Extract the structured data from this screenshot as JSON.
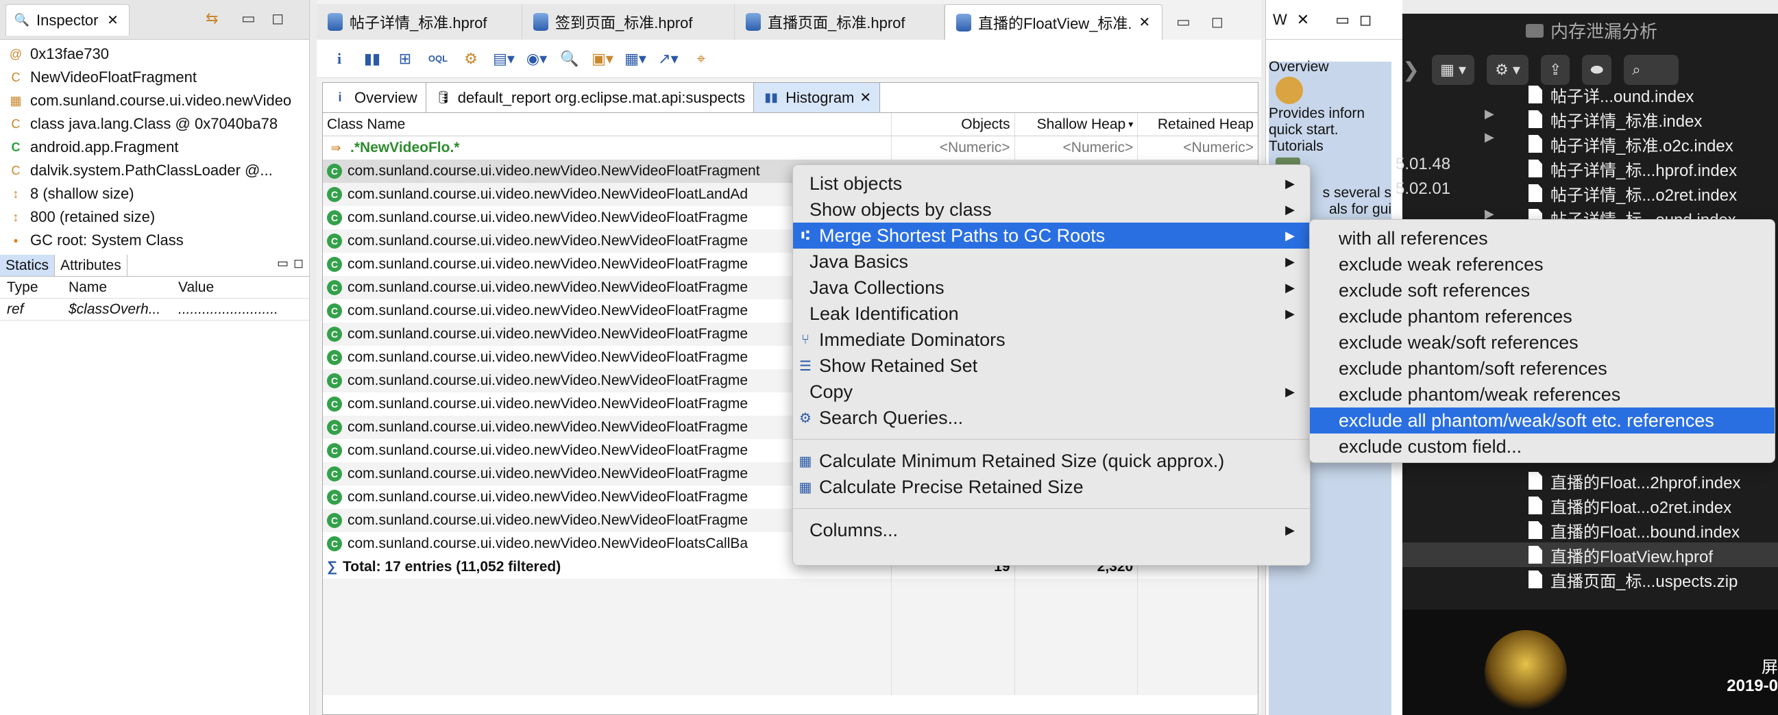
{
  "inspector": {
    "tab_label": "Inspector",
    "rows": [
      {
        "icon": "at-icon",
        "text": "0x13fae730"
      },
      {
        "icon": "class-icon",
        "text": "NewVideoFloatFragment"
      },
      {
        "icon": "package-icon",
        "text": "com.sunland.course.ui.video.newVideo"
      },
      {
        "icon": "class-object-icon",
        "text": "class java.lang.Class @ 0x7040ba78"
      },
      {
        "icon": "superclass-icon",
        "text": "android.app.Fragment"
      },
      {
        "icon": "classloader-icon",
        "text": "dalvik.system.PathClassLoader @..."
      },
      {
        "icon": "size-icon",
        "text": "8 (shallow size)"
      },
      {
        "icon": "size-icon",
        "text": "800 (retained size)"
      },
      {
        "icon": "gc-root-icon",
        "text": "GC root: System Class"
      }
    ],
    "sub_tabs": [
      "Statics",
      "Attributes"
    ],
    "columns": [
      "Type",
      "Name",
      "Value"
    ],
    "values": [
      {
        "type": "ref",
        "name": "$classOverh...",
        "value": "........................."
      }
    ]
  },
  "editor": {
    "tabs": [
      "帖子详情_标准.hprof",
      "签到页面_标准.hprof",
      "直播页面_标准.hprof",
      "直播的FloatView_标准."
    ],
    "sub_tabs": [
      "Overview",
      "default_report  org.eclipse.mat.api:suspects",
      "Histogram"
    ],
    "columns": {
      "class_name": "Class Name",
      "objects": "Objects",
      "shallow": "Shallow Heap",
      "retained": "Retained Heap"
    },
    "filter_row": {
      "class": ".*NewVideoFlo.*",
      "objects": "<Numeric>",
      "shallow": "<Numeric>",
      "retained": "<Numeric>"
    },
    "rows": [
      "com.sunland.course.ui.video.newVideo.NewVideoFloatFragment",
      "com.sunland.course.ui.video.newVideo.NewVideoFloatLandAd",
      "com.sunland.course.ui.video.newVideo.NewVideoFloatFragme",
      "com.sunland.course.ui.video.newVideo.NewVideoFloatFragme",
      "com.sunland.course.ui.video.newVideo.NewVideoFloatFragme",
      "com.sunland.course.ui.video.newVideo.NewVideoFloatFragme",
      "com.sunland.course.ui.video.newVideo.NewVideoFloatFragme",
      "com.sunland.course.ui.video.newVideo.NewVideoFloatFragme",
      "com.sunland.course.ui.video.newVideo.NewVideoFloatFragme",
      "com.sunland.course.ui.video.newVideo.NewVideoFloatFragme",
      "com.sunland.course.ui.video.newVideo.NewVideoFloatFragme",
      "com.sunland.course.ui.video.newVideo.NewVideoFloatFragme",
      "com.sunland.course.ui.video.newVideo.NewVideoFloatFragme",
      "com.sunland.course.ui.video.newVideo.NewVideoFloatFragme",
      "com.sunland.course.ui.video.newVideo.NewVideoFloatFragme",
      "com.sunland.course.ui.video.newVideo.NewVideoFloatFragme",
      "com.sunland.course.ui.video.newVideo.NewVideoFloatsCallBa"
    ],
    "total": {
      "label": "Total: 17 entries (11,052 filtered)",
      "objects": "19",
      "shallow": "2,320"
    }
  },
  "context_menu": {
    "items": [
      {
        "label": "List objects",
        "submenu": true
      },
      {
        "label": "Show objects by class",
        "submenu": true
      },
      {
        "label": "Merge Shortest Paths to GC Roots",
        "submenu": true,
        "highlighted": true,
        "icon": "merge-paths-icon"
      },
      {
        "label": "Java Basics",
        "submenu": true
      },
      {
        "label": "Java Collections",
        "submenu": true
      },
      {
        "label": "Leak Identification",
        "submenu": true
      },
      {
        "label": "Immediate Dominators",
        "icon": "dominators-icon"
      },
      {
        "label": "Show Retained Set",
        "icon": "retained-set-icon"
      },
      {
        "label": "Copy",
        "submenu": true
      },
      {
        "label": "Search Queries...",
        "icon": "search-queries-icon"
      },
      {
        "label": "Calculate Minimum Retained Size (quick approx.)",
        "icon": "calculator-icon"
      },
      {
        "label": "Calculate Precise Retained Size",
        "icon": "calculator-icon"
      },
      {
        "label": "Columns...",
        "submenu": true
      }
    ]
  },
  "submenu": {
    "items": [
      "with all references",
      "exclude weak references",
      "exclude soft references",
      "exclude phantom references",
      "exclude weak/soft references",
      "exclude phantom/soft references",
      "exclude phantom/weak references",
      "exclude all phantom/weak/soft etc. references",
      "exclude custom field..."
    ],
    "highlighted_index": 7
  },
  "welcome": {
    "tab_label": "W",
    "overview": "Overview",
    "text1": "Provides inforn",
    "text2": "quick start.",
    "tutorials": "Tutorials",
    "text3": "s several s",
    "text4": "als for gui"
  },
  "finder": {
    "title": "内存泄漏分析",
    "files_top": [
      "帖子详...ound.index",
      "帖子详情_标准.index",
      "帖子详情_标准.o2c.index",
      "帖子详情_标...hprof.index",
      "帖子详情_标...o2ret.index",
      "帖子详情_标...ound.index"
    ],
    "dates": [
      "5.01.48",
      "5.02.01"
    ],
    "files_bottom": [
      "直播的Float...2hprof.index",
      "直播的Float...o2ret.index",
      "直播的Float...bound.index",
      "直播的FloatView.hprof",
      "直播页面_标...uspects.zip"
    ],
    "selected_file": "直播的FloatView.hprof",
    "desktop_label1": "屏",
    "desktop_label2": "2019-0"
  },
  "colors": {
    "highlight": "#2a6fe2",
    "finder_bg": "#1d1d1d",
    "table_header": "#ffffff"
  }
}
